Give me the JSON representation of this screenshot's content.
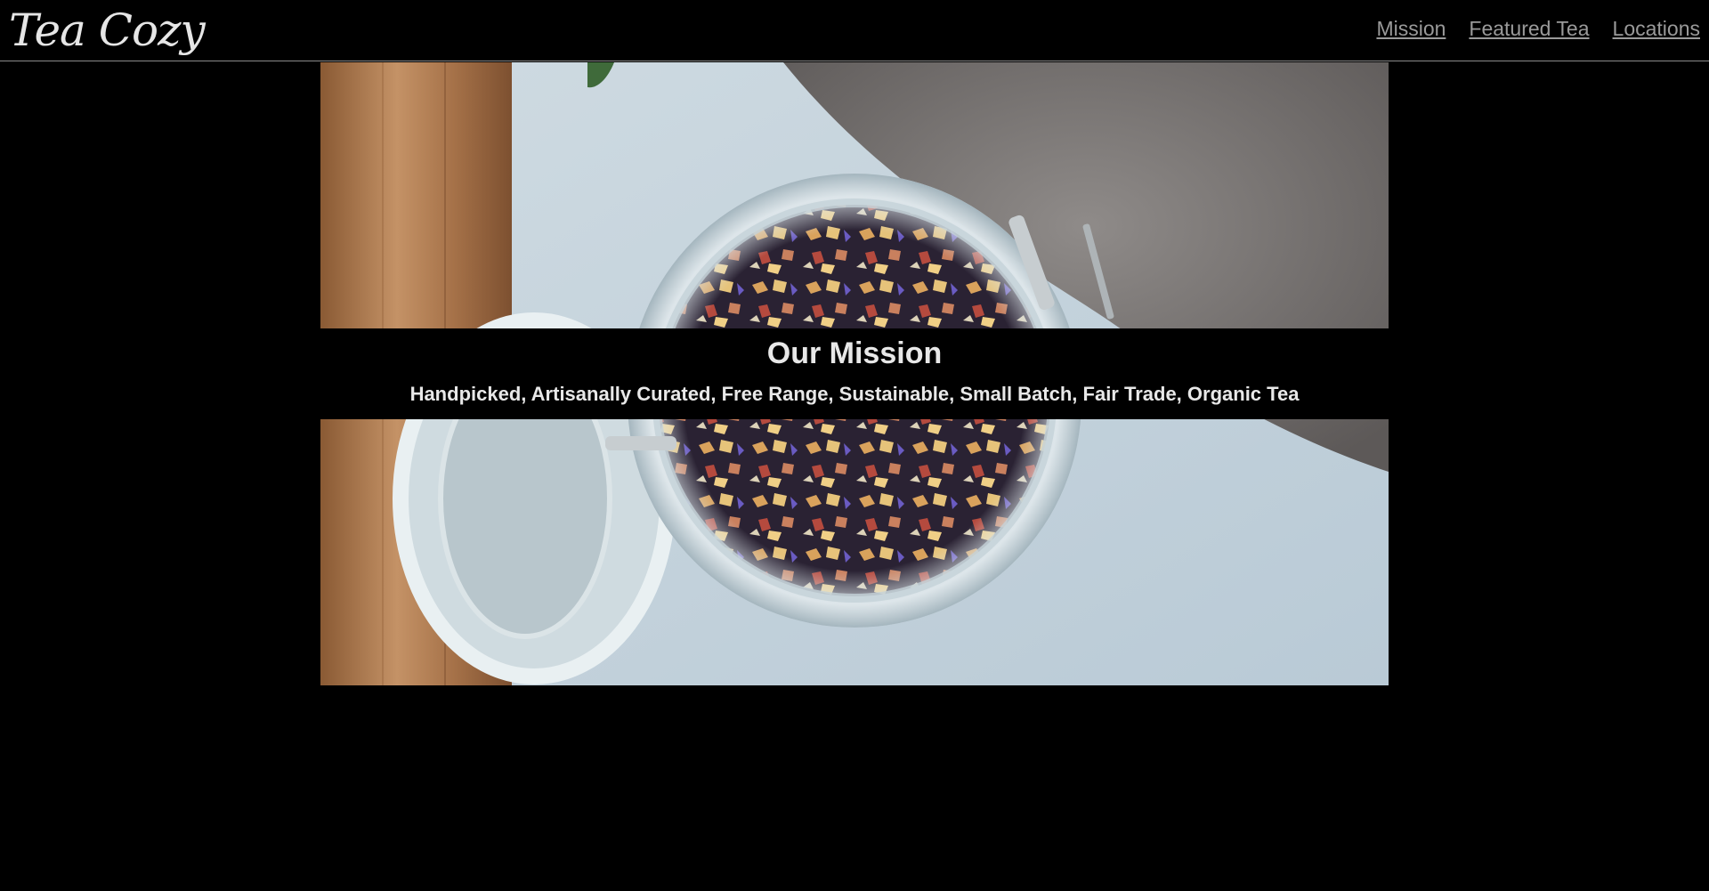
{
  "header": {
    "logo": "Tea Cozy",
    "nav": [
      {
        "label": "Mission"
      },
      {
        "label": "Featured Tea"
      },
      {
        "label": "Locations"
      }
    ]
  },
  "hero": {
    "image_alt": "tea-jar-photo",
    "title": "Our Mission",
    "subtitle": "Handpicked, Artisanally Curated, Free Range, Sustainable, Small Batch, Fair Trade, Organic Tea"
  },
  "colors": {
    "background": "#000000",
    "text": "#e8e8e8",
    "nav_link": "#9a9a9a",
    "header_border": "#8a8a8a"
  }
}
